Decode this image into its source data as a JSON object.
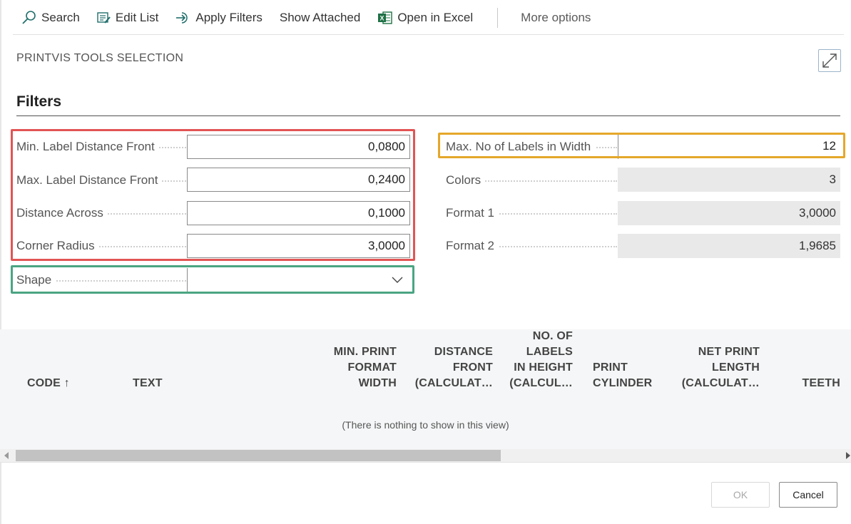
{
  "toolbar": {
    "search": "Search",
    "edit_list": "Edit List",
    "apply_filters": "Apply Filters",
    "show_attached": "Show Attached",
    "open_in_excel": "Open in Excel",
    "more_options": "More options"
  },
  "page": {
    "caption": "PRINTVIS TOOLS SELECTION",
    "section_title": "Filters"
  },
  "filters_left": {
    "min_label_distance_front": {
      "label": "Min. Label Distance Front",
      "value": "0,0800"
    },
    "max_label_distance_front": {
      "label": "Max. Label Distance Front",
      "value": "0,2400"
    },
    "distance_across": {
      "label": "Distance Across",
      "value": "0,1000"
    },
    "corner_radius": {
      "label": "Corner Radius",
      "value": "3,0000"
    },
    "shape": {
      "label": "Shape",
      "value": ""
    }
  },
  "filters_right": {
    "max_labels_width": {
      "label": "Max. No of Labels in Width",
      "value": "12"
    },
    "colors": {
      "label": "Colors",
      "value": "3"
    },
    "format1": {
      "label": "Format 1",
      "value": "3,0000"
    },
    "format2": {
      "label": "Format 2",
      "value": "1,9685"
    }
  },
  "grid": {
    "columns": {
      "code": "CODE",
      "code_sort": "↑",
      "text": "TEXT",
      "min_print_l1": "MIN. PRINT",
      "min_print_l2": "FORMAT",
      "min_print_l3": "WIDTH",
      "dist_front_l1": "DISTANCE",
      "dist_front_l2": "FRONT",
      "dist_front_l3": "(CALCULAT…",
      "labels_h_l1": "NO. OF",
      "labels_h_l2": "LABELS",
      "labels_h_l3": "IN HEIGHT",
      "labels_h_l4": "(CALCUL…",
      "cyl_l1": "PRINT",
      "cyl_l2": "CYLINDER",
      "npl_l1": "NET PRINT",
      "npl_l2": "LENGTH",
      "npl_l3": "(CALCULAT…",
      "teeth": "TEETH"
    },
    "empty_message": "(There is nothing to show in this view)"
  },
  "buttons": {
    "ok": "OK",
    "cancel": "Cancel"
  },
  "colors": {
    "highlight_red": "#e25454",
    "highlight_green": "#4aa582",
    "highlight_orange": "#e5a72a",
    "icon_teal": "#1f6f6b",
    "excel_green": "#1e7145"
  }
}
